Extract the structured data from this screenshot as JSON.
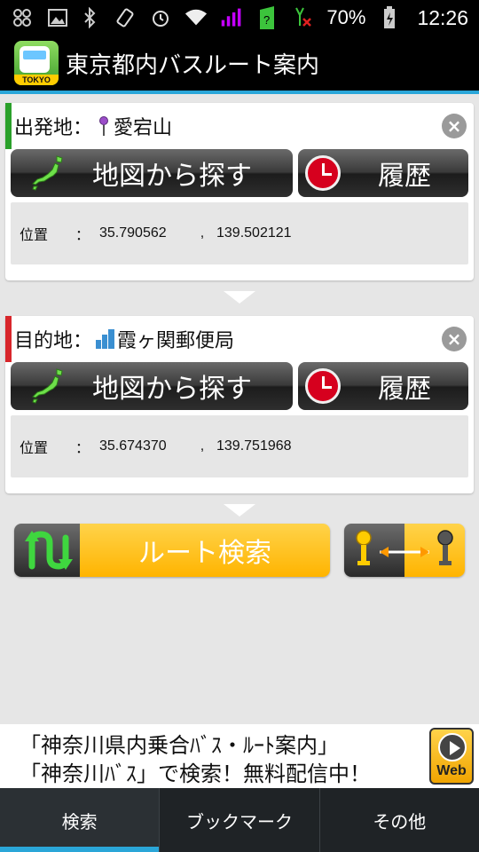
{
  "status_bar": {
    "battery": "70%",
    "time": "12:26",
    "icons": [
      "pinwheel-icon",
      "image-icon",
      "bluetooth-icon",
      "rotate-icon",
      "alarm-icon",
      "wifi-icon",
      "signal-icon",
      "data-icon",
      "signal-x-icon",
      "battery-icon"
    ]
  },
  "app_bar": {
    "logo_tag": "TOKYO",
    "title": "東京都内バスルート案内"
  },
  "origin": {
    "label": "出発地：",
    "name": "愛宕山",
    "stripe_color": "#2aa02a",
    "map_button": "地図から探す",
    "history_button": "履歴",
    "coord_label": "位置",
    "colon": "：",
    "lat": "35.790562",
    "comma": ",",
    "lon": "139.502121"
  },
  "destination": {
    "label": "目的地：",
    "name": "霞ヶ関郵便局",
    "stripe_color": "#d8262b",
    "map_button": "地図から探す",
    "history_button": "履歴",
    "coord_label": "位置",
    "colon": "：",
    "lat": "35.674370",
    "comma": ",",
    "lon": "139.751968"
  },
  "route_search": {
    "label": "ルート検索"
  },
  "ad": {
    "line1": "「神奈川県内乗合ﾊﾞｽ・ﾙｰﾄ案内」",
    "line2": "「神奈川ﾊﾞｽ」で検索！無料配信中！",
    "web_label": "Web"
  },
  "tabs": [
    {
      "label": "検索",
      "active": true
    },
    {
      "label": "ブックマーク",
      "active": false
    },
    {
      "label": "その他",
      "active": false
    }
  ],
  "colors": {
    "accent": "#2aa6d8",
    "route_orange": "#ffb400"
  }
}
